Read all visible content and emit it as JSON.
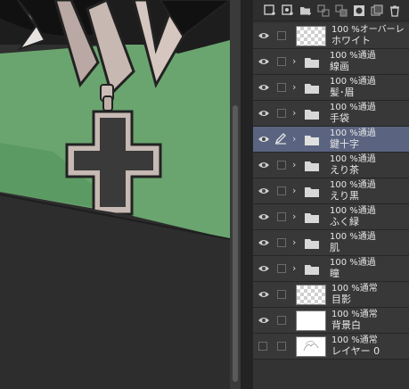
{
  "layer_panel": {
    "toolbar_icons": [
      "new-raster-layer-icon",
      "new-vector-layer-icon",
      "new-folder-icon",
      "transfer-down-icon",
      "merge-down-icon",
      "mask-icon",
      "copy-layer-icon",
      "delete-layer-icon"
    ],
    "selection_color": "#5a6480",
    "layers": [
      {
        "kind": "raster",
        "visible": true,
        "thumb": "checker",
        "opacity_mode": "100 %オーバーレ",
        "name": "ホワイト"
      },
      {
        "kind": "folder",
        "visible": true,
        "opacity_mode": "100 %通過",
        "name": "線画"
      },
      {
        "kind": "folder",
        "visible": true,
        "opacity_mode": "100 %通過",
        "name": "髪･眉"
      },
      {
        "kind": "folder",
        "visible": true,
        "opacity_mode": "100 %通過",
        "name": "手袋"
      },
      {
        "kind": "folder",
        "visible": true,
        "selected": true,
        "editing": true,
        "opacity_mode": "100 %通過",
        "name": "鍵十字"
      },
      {
        "kind": "folder",
        "visible": true,
        "opacity_mode": "100 %通過",
        "name": "えり茶"
      },
      {
        "kind": "folder",
        "visible": true,
        "opacity_mode": "100 %通過",
        "name": "えり黒"
      },
      {
        "kind": "folder",
        "visible": true,
        "opacity_mode": "100 %通過",
        "name": "ふく緑"
      },
      {
        "kind": "folder",
        "visible": true,
        "opacity_mode": "100 %通過",
        "name": "肌"
      },
      {
        "kind": "folder",
        "visible": true,
        "opacity_mode": "100 %通過",
        "name": "瞳"
      },
      {
        "kind": "raster",
        "visible": true,
        "thumb": "checker",
        "opacity_mode": "100 %通常",
        "name": "目影"
      },
      {
        "kind": "raster",
        "visible": true,
        "thumb": "white",
        "opacity_mode": "100 %通常",
        "name": "背景白"
      },
      {
        "kind": "raster",
        "visible": false,
        "thumb": "sketch",
        "opacity_mode": "100 %通常",
        "name": "レイヤー 0"
      }
    ]
  }
}
